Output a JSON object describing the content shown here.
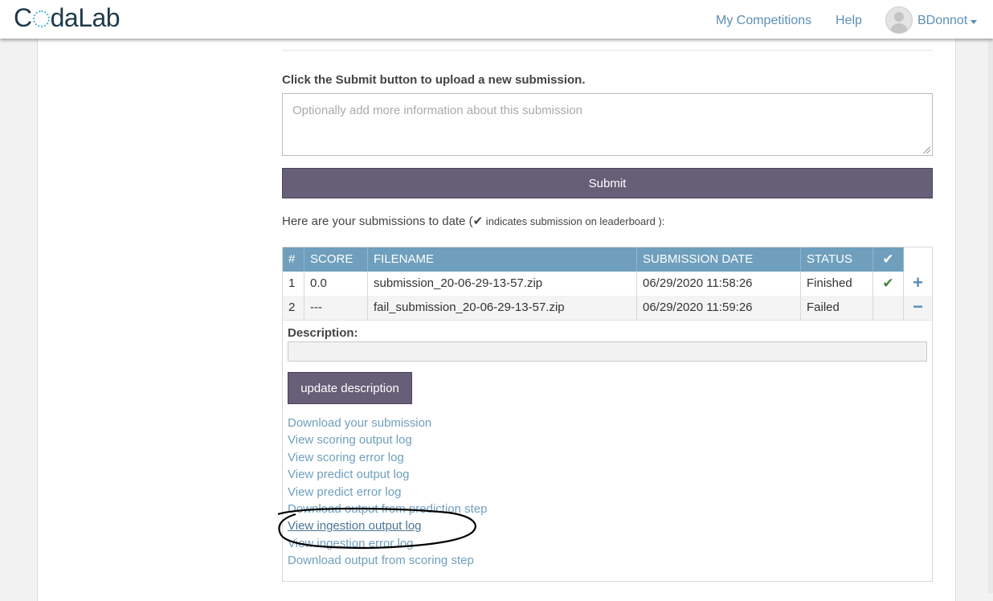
{
  "nav": {
    "logo": {
      "before": "C",
      "after": "daLab"
    },
    "links": [
      "My Competitions",
      "Help"
    ],
    "user": "BDonnot"
  },
  "form": {
    "prompt": "Click the Submit button to upload a new submission.",
    "placeholder": "Optionally add more information about this submission",
    "submit_label": "Submit"
  },
  "intro": {
    "text": "Here are your submissions to date (",
    "check": "✔",
    "note": " indicates submission on leaderboard ",
    "close": "):"
  },
  "table": {
    "headers": [
      "#",
      "SCORE",
      "FILENAME",
      "SUBMISSION DATE",
      "STATUS",
      "✔"
    ],
    "rows": [
      {
        "num": "1",
        "score": "0.0",
        "filename": "submission_20-06-29-13-57.zip",
        "date": "06/29/2020 11:58:26",
        "status": "Finished",
        "leaderboard": "✔",
        "action": "+"
      },
      {
        "num": "2",
        "score": "---",
        "filename": "fail_submission_20-06-29-13-57.zip",
        "date": "06/29/2020 11:59:26",
        "status": "Failed",
        "leaderboard": "",
        "action": "−"
      }
    ]
  },
  "details": {
    "description_label": "Description:",
    "update_label": "update description",
    "links": [
      "Download your submission",
      "View scoring output log",
      "View scoring error log",
      "View predict output log",
      "View predict error log",
      "Download output from prediction step",
      "View ingestion output log",
      "View ingestion error log",
      "Download output from scoring step"
    ]
  },
  "colors": {
    "accent": "#6f9fbd",
    "button": "#675f78",
    "link": "#6f9fbd",
    "success": "#3c8a3c"
  },
  "icons": [
    "user-avatar-icon",
    "chevron-down-icon",
    "check-icon",
    "plus-icon",
    "minus-icon",
    "resize-handle-icon"
  ]
}
